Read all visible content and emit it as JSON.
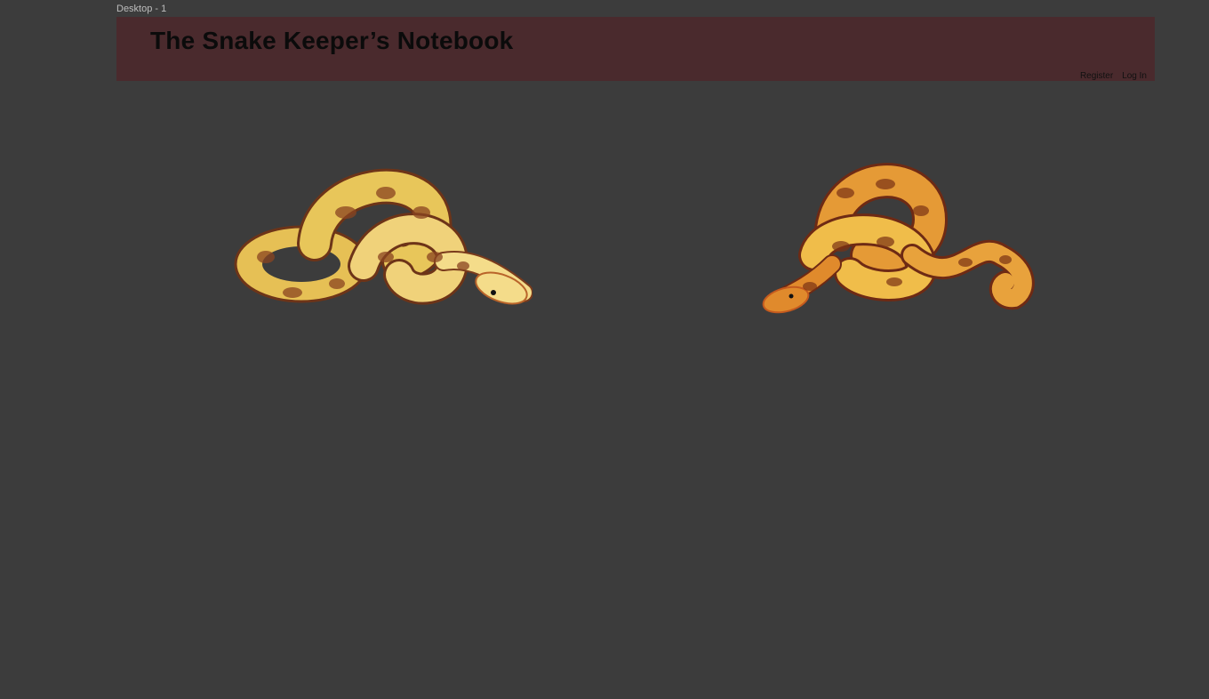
{
  "frame": {
    "label": "Desktop - 1"
  },
  "header": {
    "title": "The Snake Keeper’s Notebook",
    "register_label": "Register",
    "login_label": "Log In"
  },
  "images": [
    {
      "name": "yellow-ball-python",
      "colors": [
        "#e8c65a",
        "#f4dc8a",
        "#7a3b1c",
        "#b9642a"
      ]
    },
    {
      "name": "orange-ball-python",
      "colors": [
        "#e08a2c",
        "#f0bd4a",
        "#6e2a14",
        "#c45a1e"
      ]
    }
  ]
}
